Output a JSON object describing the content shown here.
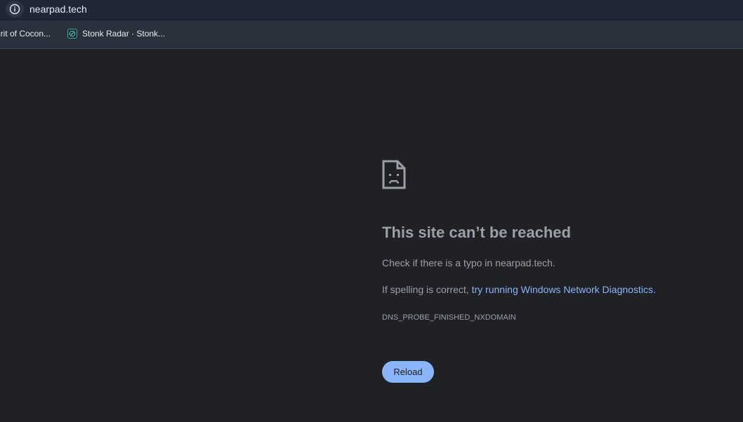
{
  "browser": {
    "url": "nearpad.tech",
    "bookmarks": [
      {
        "label": "irit of Cocon...",
        "icon": "page-icon"
      },
      {
        "label": "Stonk Radar · Stonk...",
        "icon": "stonk-radar-favicon"
      }
    ]
  },
  "error_page": {
    "icon": "sad-page-icon",
    "title": "This site can’t be reached",
    "check_text": "Check if there is a typo in nearpad.tech.",
    "spelling_prefix": "If spelling is correct, ",
    "diagnostics_link": "try running Windows Network Diagnostics",
    "spelling_suffix": ".",
    "error_code": "DNS_PROBE_FINISHED_NXDOMAIN",
    "reload_label": "Reload"
  },
  "colors": {
    "background": "#202124",
    "text": "#9aa0a6",
    "link": "#8ab4f8",
    "button": "#8ab4f8"
  }
}
